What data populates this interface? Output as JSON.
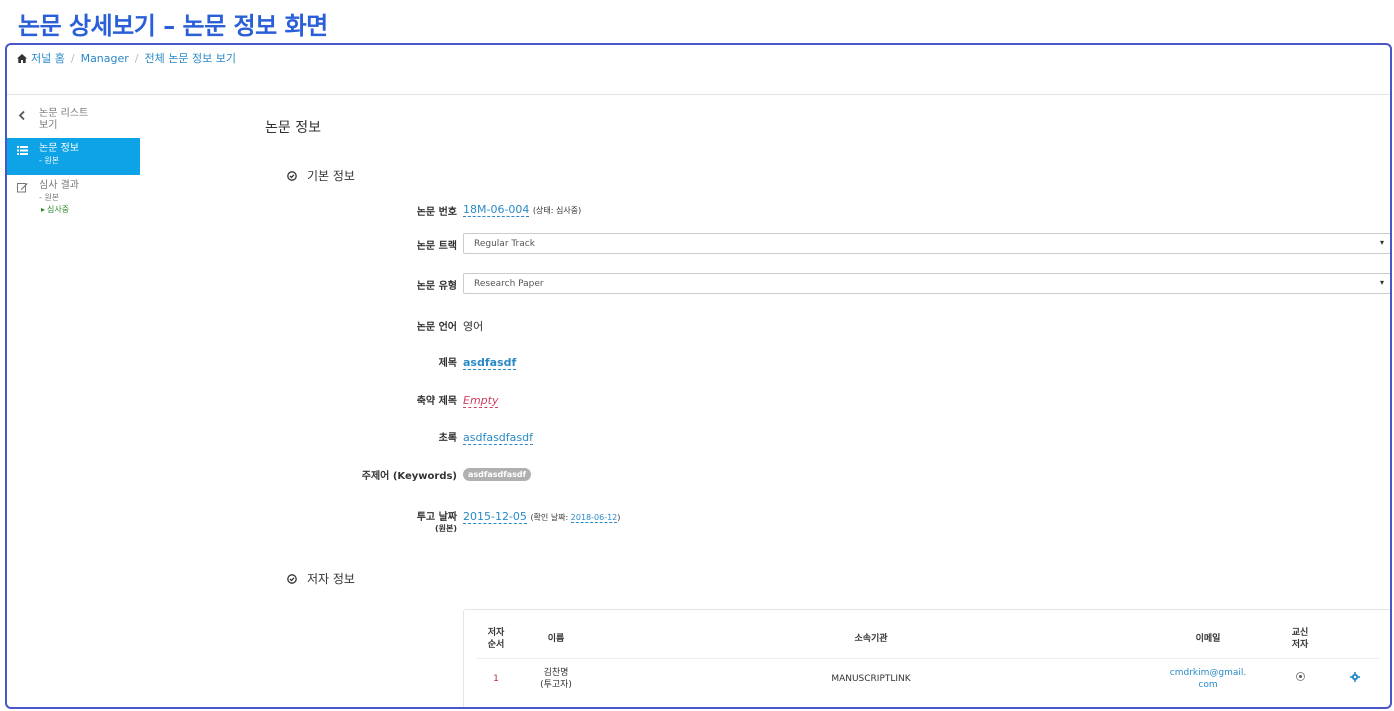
{
  "page": {
    "title": "논문 상세보기 – 논문 정보 화면"
  },
  "breadcrumb": {
    "home": "저널 홈",
    "manager": "Manager",
    "current": "전체 논문 정보 보기"
  },
  "sidebar": {
    "back": {
      "label1": "논문 리스트",
      "label2": "보기",
      "icon": "chevron-left-icon"
    },
    "info": {
      "label": "논문 정보",
      "sub": "- 원본",
      "icon": "list-icon"
    },
    "review": {
      "label": "심사 결과",
      "sub": "- 원본",
      "status": "심사중",
      "icon": "edit-icon"
    }
  },
  "main": {
    "section_title": "논문 정보",
    "basic_title": "기본 정보",
    "author_title": "저자 정보",
    "fields": {
      "number_label": "논문 번호",
      "number_value": "18M-06-004",
      "number_status": "(상태: 심사중)",
      "track_label": "논문 트랙",
      "track_value": "Regular Track",
      "type_label": "논문 유형",
      "type_value": "Research Paper",
      "language_label": "논문 언어",
      "language_value": "영어",
      "title_label": "제목",
      "title_value": "asdfasdf",
      "short_title_label": "축약 제목",
      "short_title_value": "Empty",
      "abstract_label": "초록",
      "abstract_value": "asdfasdfasdf",
      "keywords_label": "주제어 (Keywords)",
      "keyword_tag": "asdfasdfasdf",
      "date_label": "투고 날짜",
      "date_sub": "(원본)",
      "date_value": "2015-12-05",
      "confirm_prefix": "(확인 날짜: ",
      "confirm_date": "2018-06-12",
      "confirm_suffix": ")"
    },
    "authors": {
      "headers": {
        "order1": "저자",
        "order2": "순서",
        "name": "이름",
        "affiliation": "소속기관",
        "email": "이메일",
        "corr1": "교신",
        "corr2": "저자"
      },
      "rows": [
        {
          "order": "1",
          "name1": "김찬명",
          "name2": "(투고자)",
          "affiliation": "MANUSCRIPTLINK",
          "email1": "cmdrkim@gmail.",
          "email2": "com"
        }
      ]
    }
  },
  "colors": {
    "accent": "#0ea2e6",
    "title": "#2a5fd8",
    "frame": "#4a55c8",
    "link": "#2a8ac8"
  }
}
